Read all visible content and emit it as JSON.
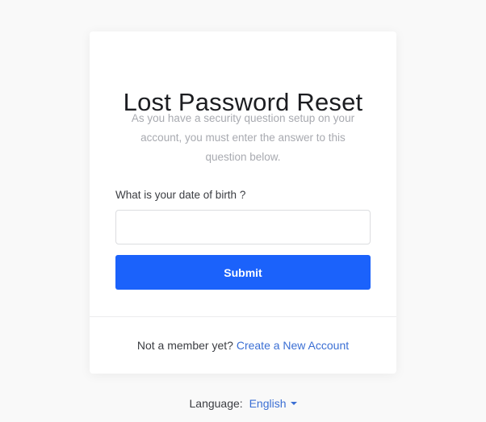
{
  "page": {
    "title": "Lost Password Reset",
    "intro": "As you have a security question setup on your account, you must enter the answer to this question below."
  },
  "form": {
    "question_label": "What is your date of birth ?",
    "answer_value": "",
    "answer_placeholder": "",
    "submit_label": "Submit"
  },
  "footer": {
    "member_text": "Not a member yet?",
    "create_account_link": "Create a New Account"
  },
  "language": {
    "label": "Language:",
    "selected": "English",
    "icon": "caret-down-icon"
  },
  "colors": {
    "primary_button": "#1b62fb",
    "link": "#3b6fd4",
    "background": "#f9f9f9"
  }
}
